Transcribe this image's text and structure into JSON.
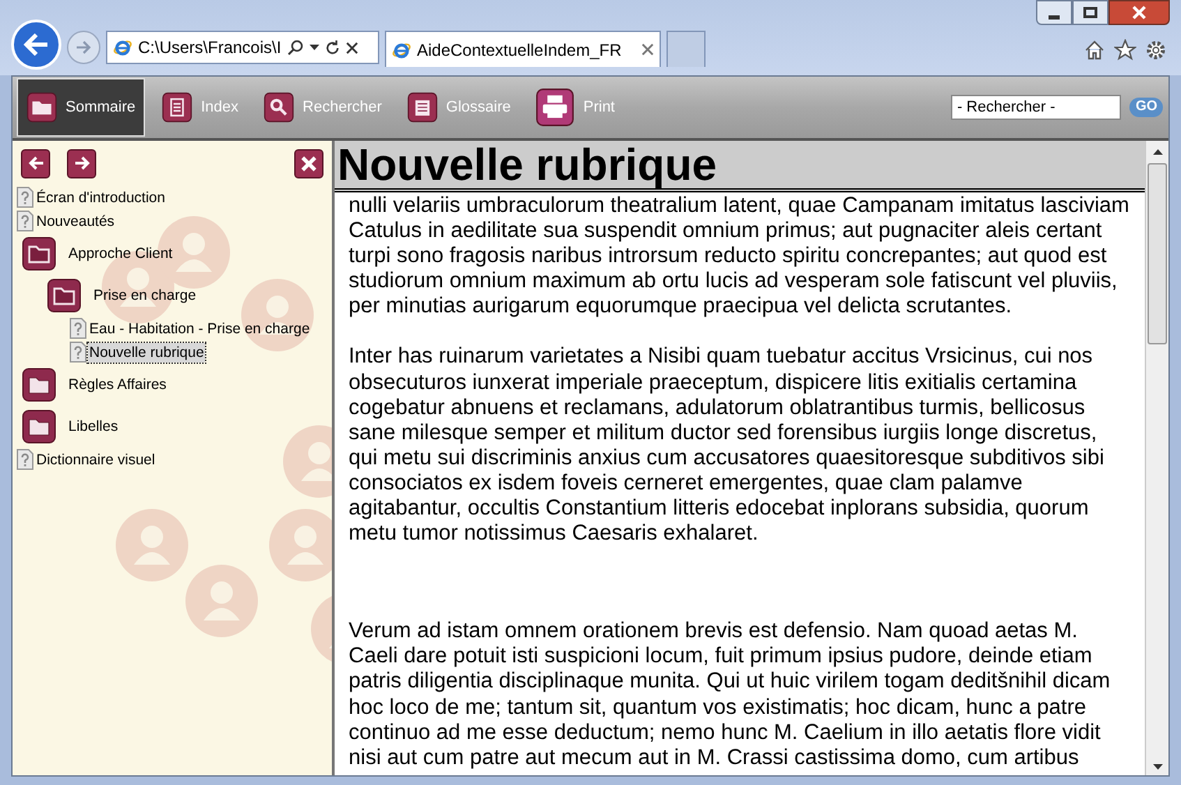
{
  "browser": {
    "address": "C:\\Users\\Francois\\I",
    "tabs": [
      {
        "label": "AideContextuelleIndem_FR",
        "selected": true
      }
    ]
  },
  "toolbar": {
    "buttons": [
      {
        "label": "Sommaire",
        "kind": "folder",
        "selected": true
      },
      {
        "label": "Index",
        "kind": "index",
        "selected": false
      },
      {
        "label": "Rechercher",
        "kind": "search",
        "selected": false
      },
      {
        "label": "Glossaire",
        "kind": "glossary",
        "selected": false
      },
      {
        "label": "Print",
        "kind": "print",
        "selected": false
      }
    ],
    "search": {
      "value": "- Rechercher -",
      "button": "GO"
    }
  },
  "tree": [
    {
      "label": "Écran d'introduction",
      "kind": "page",
      "selected": false
    },
    {
      "label": "Nouveautés",
      "kind": "page",
      "selected": false
    },
    {
      "label": "Approche Client",
      "kind": "folder",
      "selected": false,
      "expanded": true,
      "children": [
        {
          "label": "Prise en charge",
          "kind": "folder",
          "selected": false,
          "expanded": true,
          "children": [
            {
              "label": "Eau - Habitation - Prise en charge",
              "kind": "page",
              "selected": false
            },
            {
              "label": "Nouvelle rubrique",
              "kind": "page",
              "selected": true
            }
          ]
        }
      ]
    },
    {
      "label": "Règles Affaires",
      "kind": "folder",
      "selected": false,
      "expanded": false
    },
    {
      "label": "Libelles",
      "kind": "folder",
      "selected": false,
      "expanded": false
    },
    {
      "label": "Dictionnaire visuel",
      "kind": "page",
      "selected": false
    }
  ],
  "content": {
    "title": "Nouvelle rubrique",
    "paragraphs": [
      "nulli velariis umbraculorum theatralium latent, quae Campanam imitatus lasciviam Catulus in aedilitate sua suspendit omnium primus; aut pugnaciter aleis certant turpi sono fragosis naribus introrsum reducto spiritu concrepantes; aut quod est studiorum omnium maximum ab ortu lucis ad vesperam sole fatiscunt vel pluviis, per minutias aurigarum equorumque praecipua vel delicta scrutantes.",
      "Inter has ruinarum varietates a Nisibi quam tuebatur accitus Vrsicinus, cui nos obsecuturos iunxerat imperiale praeceptum, dispicere litis exitialis certamina cogebatur abnuens et reclamans, adulatorum oblatrantibus turmis, bellicosus sane milesque semper et militum ductor sed forensibus iurgiis longe discretus, qui metu sui discriminis anxius cum accusatores quaesitoresque subditivos sibi consociatos ex isdem foveis cerneret emergentes, quae clam palamve agitabantur, occultis Constantium litteris edocebat inplorans subsidia, quorum metu tumor notissimus Caesaris exhalaret.",
      "Verum ad istam omnem orationem brevis est defensio. Nam quoad aetas M. Caeli dare potuit isti suspicioni locum, fuit primum ipsius pudore, deinde etiam patris diligentia disciplinaque munita. Qui ut huic virilem togam deditšnihil dicam hoc loco de me; tantum sit, quantum vos existimatis; hoc dicam, hunc a patre continuo ad me esse deductum; nemo hunc M. Caelium in illo aetatis flore vidit nisi aut cum patre aut mecum aut in M. Crassi castissima domo, cum artibus"
    ]
  }
}
